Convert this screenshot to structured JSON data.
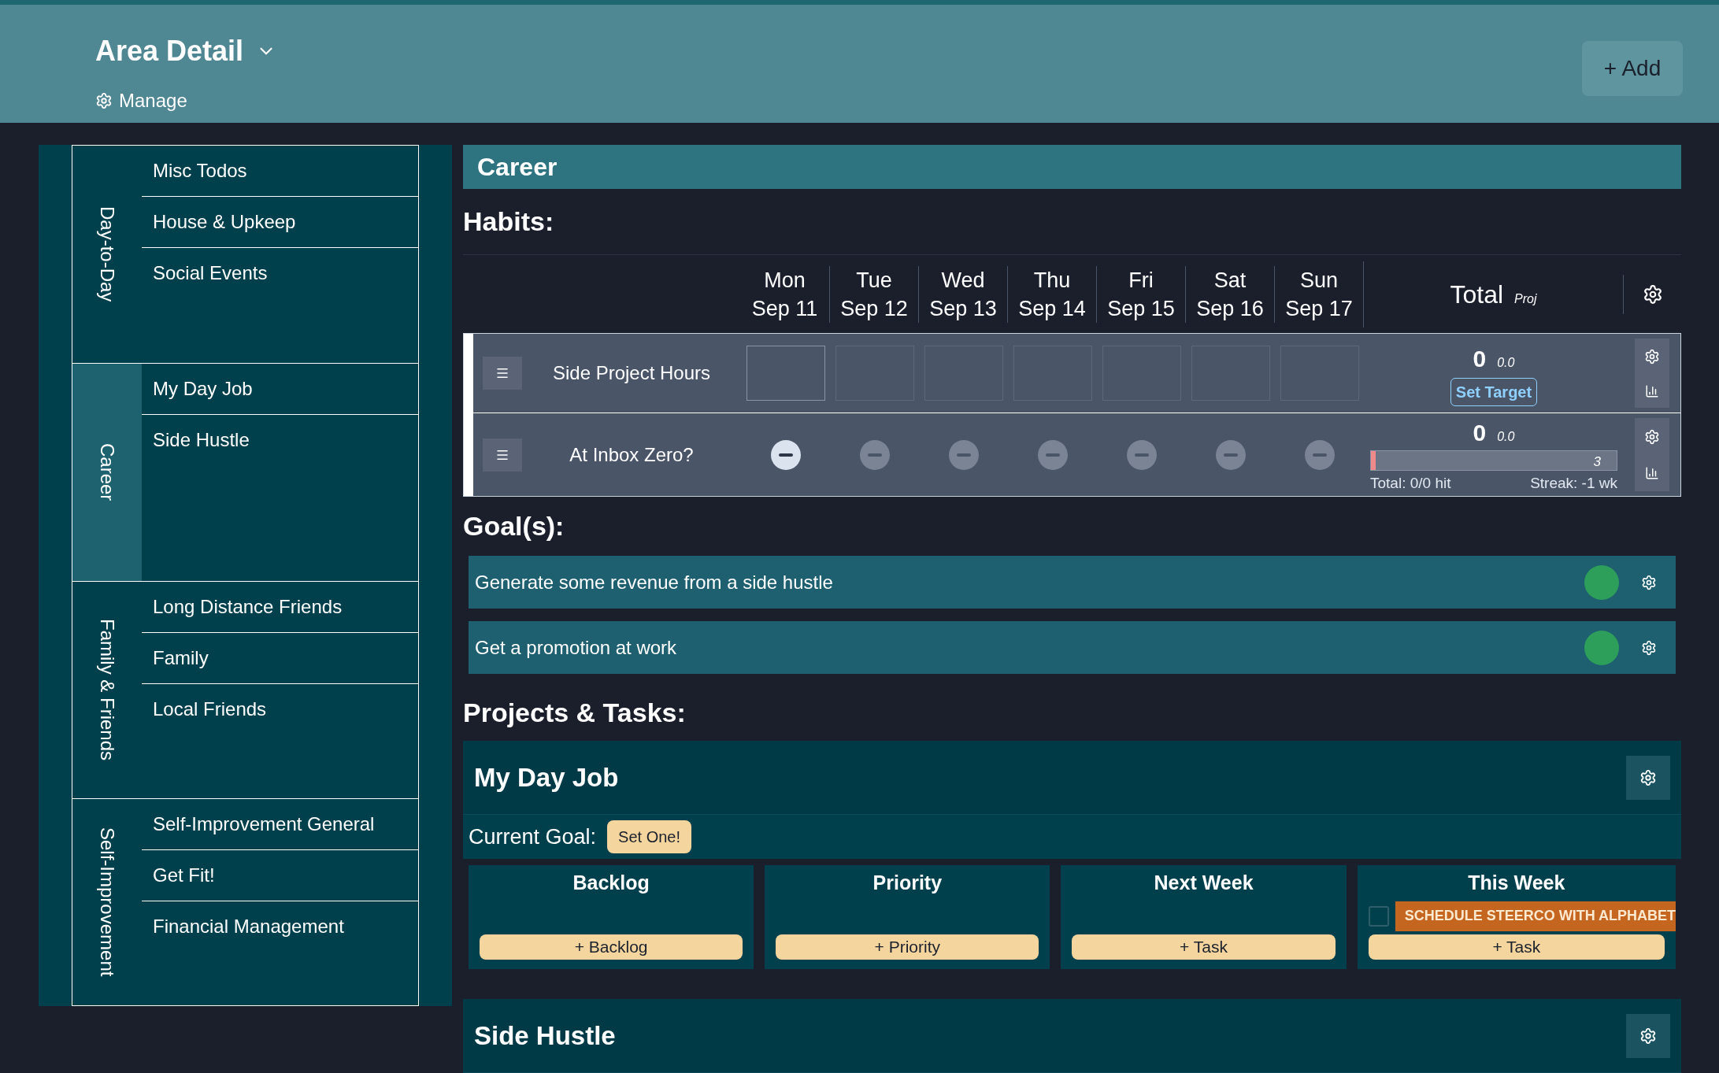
{
  "header": {
    "title": "Area Detail",
    "manage_label": "Manage",
    "add_button": "+ Add"
  },
  "sidebar": {
    "groups": [
      {
        "label": "Day-to-Day",
        "selected": false,
        "items": [
          {
            "label": "Misc Todos"
          },
          {
            "label": "House & Upkeep"
          },
          {
            "label": "Social Events"
          }
        ]
      },
      {
        "label": "Career",
        "selected": true,
        "items": [
          {
            "label": "My Day Job"
          },
          {
            "label": "Side Hustle"
          }
        ]
      },
      {
        "label": "Family & Friends",
        "selected": false,
        "items": [
          {
            "label": "Long Distance Friends"
          },
          {
            "label": "Family"
          },
          {
            "label": "Local Friends"
          }
        ]
      },
      {
        "label": "Self-Improvement",
        "selected": false,
        "items": [
          {
            "label": "Self-Improvement General"
          },
          {
            "label": "Get Fit!"
          },
          {
            "label": "Financial Management"
          }
        ]
      }
    ]
  },
  "area_title": "Career",
  "habits": {
    "heading": "Habits:",
    "total_label": "Total",
    "proj_label": "Proj",
    "days": [
      {
        "day": "Mon",
        "date": "Sep 11"
      },
      {
        "day": "Tue",
        "date": "Sep 12"
      },
      {
        "day": "Wed",
        "date": "Sep 13"
      },
      {
        "day": "Thu",
        "date": "Sep 14"
      },
      {
        "day": "Fri",
        "date": "Sep 15"
      },
      {
        "day": "Sat",
        "date": "Sep 16"
      },
      {
        "day": "Sun",
        "date": "Sep 17"
      }
    ],
    "rows": [
      {
        "kind": "number",
        "name": "Side Project Hours",
        "total": "0",
        "proj": "0.0",
        "target_button": "Set Target",
        "cells": [
          {
            "selected": true
          },
          {
            "selected": false
          },
          {
            "selected": false
          },
          {
            "selected": false
          },
          {
            "selected": false
          },
          {
            "selected": false
          },
          {
            "selected": false
          }
        ]
      },
      {
        "kind": "check",
        "name": "At Inbox Zero?",
        "total": "0",
        "proj": "0.0",
        "level": 0.02,
        "bar_label": "3",
        "hit_label": "Total: 0/0 hit",
        "streak_label": "Streak: -1 wk",
        "cells": [
          {
            "selected": true
          },
          {
            "selected": false
          },
          {
            "selected": false
          },
          {
            "selected": false
          },
          {
            "selected": false
          },
          {
            "selected": false
          },
          {
            "selected": false
          }
        ]
      }
    ]
  },
  "goals": {
    "heading": "Goal(s):",
    "items": [
      {
        "text": "Generate some revenue from a side hustle",
        "color": "#2e9e5b"
      },
      {
        "text": "Get a promotion at work",
        "color": "#2e9e5b"
      }
    ]
  },
  "projects": {
    "heading": "Projects & Tasks:",
    "items": [
      {
        "title": "My Day Job",
        "goal_label": "Current Goal:",
        "goal_button": "Set One!",
        "columns": [
          {
            "title": "Backlog",
            "add_button": "+ Backlog"
          },
          {
            "title": "Priority",
            "add_button": "+ Priority"
          },
          {
            "title": "Next Week",
            "add_button": "+ Task"
          },
          {
            "title": "This Week",
            "tasks": [
              {
                "text": "SCHEDULE STEERCO WITH ALPHABET",
                "checked": false
              }
            ],
            "add_button": "+ Task"
          }
        ]
      },
      {
        "title": "Side Hustle"
      }
    ]
  }
}
